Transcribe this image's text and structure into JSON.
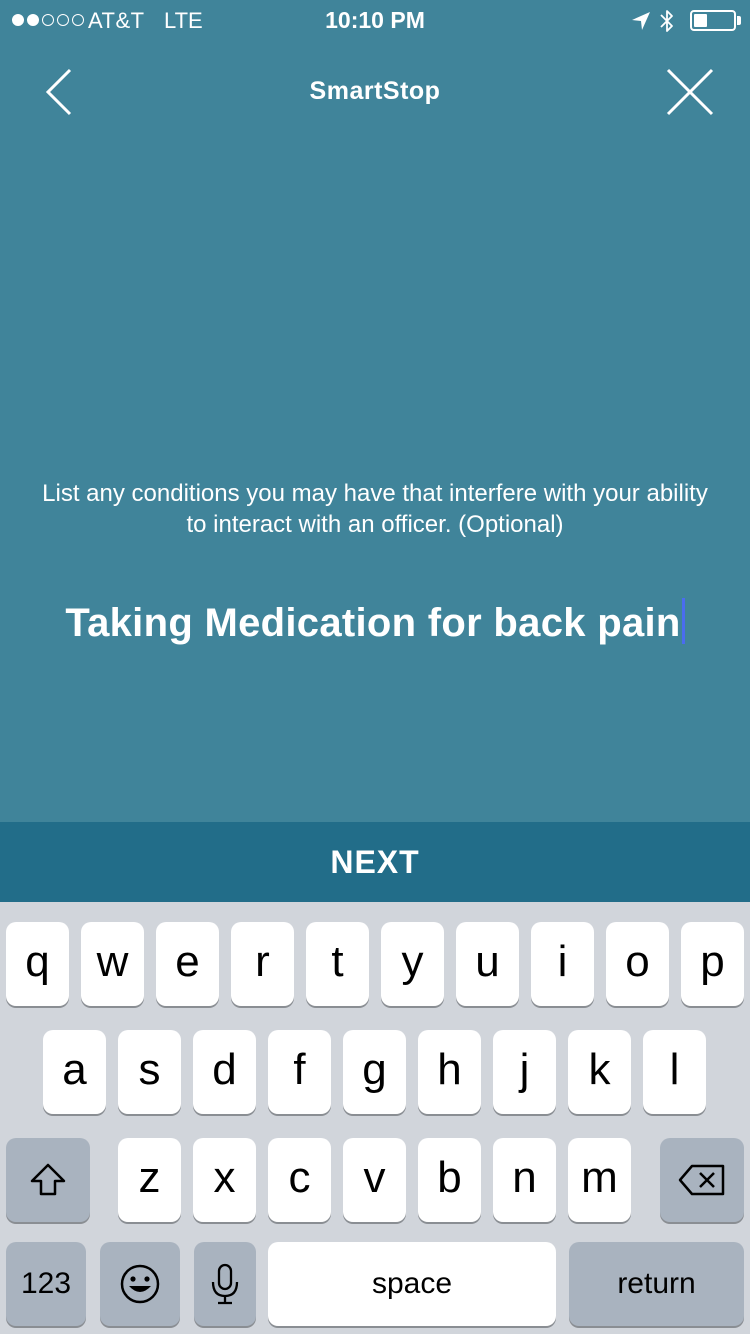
{
  "status_bar": {
    "carrier": "AT&T",
    "network": "LTE",
    "time": "10:10 PM",
    "signal_bars_filled": 2,
    "signal_bars_total": 5,
    "battery_level": 0.35
  },
  "nav": {
    "title": "SmartStop",
    "back_icon": "chevron-left-icon",
    "close_icon": "close-icon"
  },
  "prompt": {
    "question": "List any conditions you may have that interfere with your ability to interact with an officer. (Optional)",
    "answer_value": "Taking Medication for back pain"
  },
  "next_button": {
    "label": "NEXT"
  },
  "keyboard": {
    "row1": [
      "q",
      "w",
      "e",
      "r",
      "t",
      "y",
      "u",
      "i",
      "o",
      "p"
    ],
    "row2": [
      "a",
      "s",
      "d",
      "f",
      "g",
      "h",
      "j",
      "k",
      "l"
    ],
    "row3": [
      "z",
      "x",
      "c",
      "v",
      "b",
      "n",
      "m"
    ],
    "shift_icon": "shift-icon",
    "delete_icon": "delete-icon",
    "numbers_label": "123",
    "emoji_icon": "emoji-icon",
    "mic_icon": "microphone-icon",
    "space_label": "space",
    "return_label": "return"
  },
  "colors": {
    "background": "#40849a",
    "next_bar": "#226d89",
    "cursor": "#4a6cf0",
    "keyboard_bg": "#d1d5db"
  }
}
